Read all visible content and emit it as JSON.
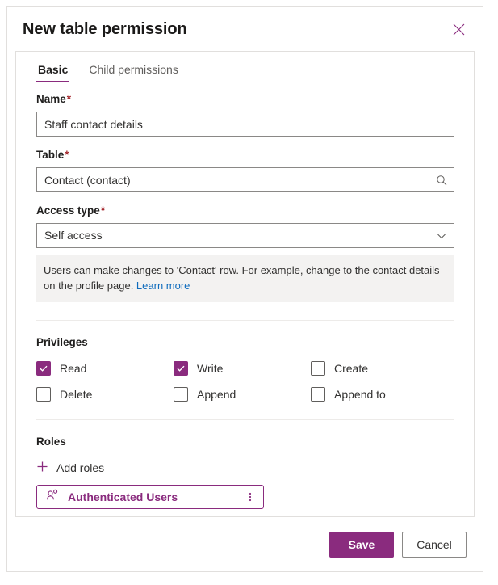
{
  "dialog": {
    "title": "New table permission",
    "close_icon": "close-icon"
  },
  "tabs": [
    {
      "label": "Basic",
      "active": true
    },
    {
      "label": "Child permissions",
      "active": false
    }
  ],
  "fields": {
    "name": {
      "label": "Name",
      "required": "*",
      "value": "Staff contact details",
      "placeholder": ""
    },
    "table": {
      "label": "Table",
      "required": "*",
      "value": "Contact (contact)",
      "placeholder": "",
      "icon": "search-icon"
    },
    "access_type": {
      "label": "Access type",
      "required": "*",
      "value": "Self access",
      "icon": "chevron-down-icon"
    }
  },
  "info": {
    "text": "Users can make changes to 'Contact' row. For example, change to the contact details on the profile page. ",
    "link_label": "Learn more"
  },
  "privileges": {
    "title": "Privileges",
    "items": [
      {
        "label": "Read",
        "checked": true
      },
      {
        "label": "Write",
        "checked": true
      },
      {
        "label": "Create",
        "checked": false
      },
      {
        "label": "Delete",
        "checked": false
      },
      {
        "label": "Append",
        "checked": false
      },
      {
        "label": "Append to",
        "checked": false
      }
    ]
  },
  "roles": {
    "title": "Roles",
    "add_label": "Add roles",
    "add_icon": "plus-icon",
    "chips": [
      {
        "label": "Authenticated Users",
        "icon": "person-role-icon",
        "menu_icon": "more-vertical-icon"
      }
    ]
  },
  "footer": {
    "save_label": "Save",
    "cancel_label": "Cancel"
  },
  "colors": {
    "accent": "#8a2b7e",
    "required": "#a4262c",
    "link": "#0f6cbd",
    "info_bg": "#f3f2f1",
    "border": "#8a8886"
  }
}
